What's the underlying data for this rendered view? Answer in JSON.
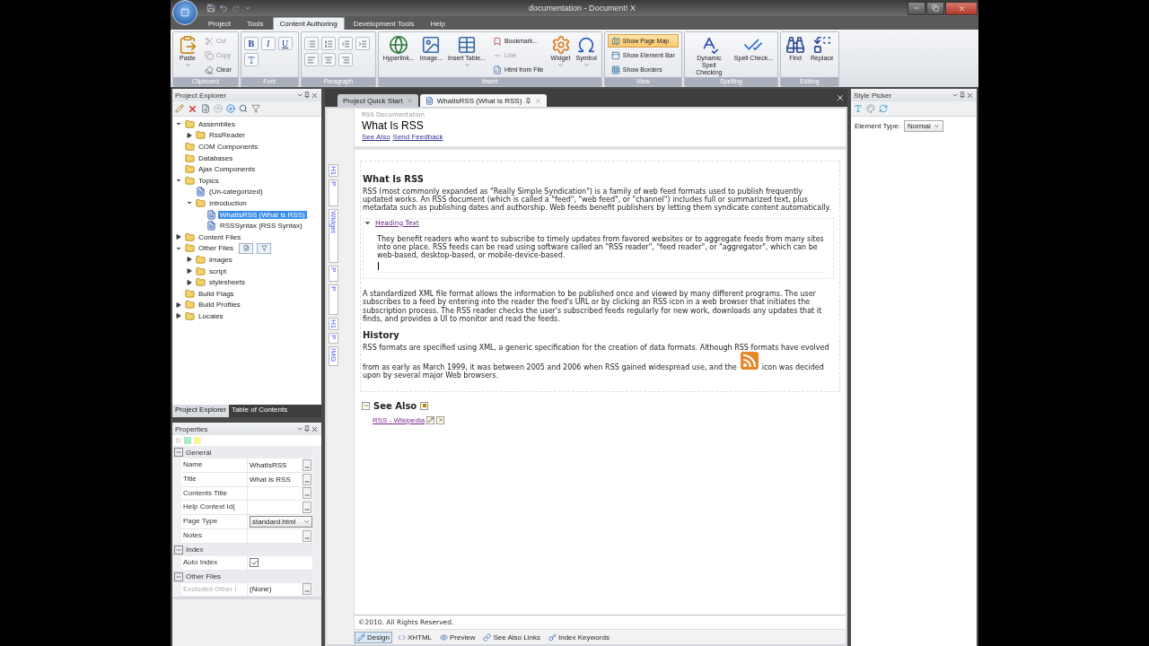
{
  "window": {
    "title": "documentation - Document! X"
  },
  "menu_tabs": [
    {
      "label": "Project",
      "selected": false
    },
    {
      "label": "Tools",
      "selected": false
    },
    {
      "label": "Content Authoring",
      "selected": true
    },
    {
      "label": "Development Tools",
      "selected": false
    },
    {
      "label": "Help",
      "selected": false
    }
  ],
  "ribbon": {
    "groups": [
      {
        "label": "Clipboard",
        "items": [
          {
            "label": "Paste",
            "kind": "large",
            "dropdown": true,
            "disabled": false
          },
          {
            "label": "Cut",
            "kind": "small",
            "disabled": true
          },
          {
            "label": "Copy",
            "kind": "small",
            "disabled": true
          },
          {
            "label": "Clear",
            "kind": "small",
            "disabled": false
          }
        ]
      },
      {
        "label": "Font",
        "items": [
          {
            "glyph": "B",
            "kind": "glyph"
          },
          {
            "glyph": "I",
            "kind": "glyph"
          },
          {
            "glyph": "U",
            "kind": "glyph"
          },
          {
            "kind": "icon"
          }
        ]
      },
      {
        "label": "Paragraph",
        "items": [
          {
            "kind": "icon"
          },
          {
            "kind": "icon"
          },
          {
            "kind": "icon"
          },
          {
            "kind": "icon"
          },
          {
            "kind": "icon"
          },
          {
            "kind": "icon"
          },
          {
            "kind": "icon"
          }
        ]
      },
      {
        "label": "Insert",
        "items": [
          {
            "label": "Hyperlink...",
            "kind": "large",
            "dropdown": false,
            "disabled": false
          },
          {
            "label": "Image...",
            "kind": "large",
            "dropdown": false,
            "disabled": false
          },
          {
            "label": "Insert Table...",
            "kind": "large",
            "dropdown": true,
            "disabled": false
          },
          {
            "label": "Bookmark...",
            "kind": "small",
            "disabled": false
          },
          {
            "label": "Line",
            "kind": "small",
            "disabled": true
          },
          {
            "label": "Html from File",
            "kind": "small",
            "disabled": false
          },
          {
            "label": "Widget",
            "kind": "large",
            "dropdown": true,
            "disabled": false
          },
          {
            "label": "Symbol",
            "kind": "large",
            "dropdown": true,
            "disabled": false
          }
        ]
      },
      {
        "label": "View",
        "items": [
          {
            "label": "Show Page Map",
            "kind": "small",
            "on": true,
            "disabled": false
          },
          {
            "label": "Show Element Bar",
            "kind": "small",
            "on": false,
            "disabled": false
          },
          {
            "label": "Show Borders",
            "kind": "small",
            "on": false,
            "disabled": false
          }
        ]
      },
      {
        "label": "Spelling",
        "items": [
          {
            "label": "Dynamic Spell Checking",
            "kind": "large",
            "dropdown": false,
            "disabled": false
          },
          {
            "label": "Spell Check...",
            "kind": "large",
            "dropdown": false,
            "disabled": false
          }
        ]
      },
      {
        "label": "Editing",
        "items": [
          {
            "label": "Find",
            "kind": "large",
            "dropdown": false,
            "disabled": false
          },
          {
            "label": "Replace",
            "kind": "large",
            "dropdown": false,
            "disabled": false
          }
        ]
      }
    ]
  },
  "project_explorer": {
    "title": "Project Explorer",
    "tree": [
      {
        "label": "Assemblies",
        "expanded": true,
        "selected": false,
        "children": [
          {
            "label": "RssReader",
            "expanded": false,
            "selected": false
          }
        ]
      },
      {
        "label": "COM Components",
        "selected": false
      },
      {
        "label": "Databases",
        "selected": false
      },
      {
        "label": "Ajax Components",
        "selected": false
      },
      {
        "label": "Topics",
        "expanded": true,
        "selected": false,
        "children": [
          {
            "label": "(Un-categorized)",
            "selected": false
          },
          {
            "label": "Introduction",
            "expanded": true,
            "selected": false,
            "children": [
              {
                "label": "WhatIsRSS (What Is RSS)",
                "selected": true
              },
              {
                "label": "RSSSyntax (RSS Syntax)",
                "selected": false
              }
            ]
          }
        ]
      },
      {
        "label": "Content Files",
        "expanded": false,
        "selected": false
      },
      {
        "label": "Other Files",
        "expanded": true,
        "selected": false,
        "actions": true,
        "children": [
          {
            "label": "images",
            "expanded": false,
            "selected": false
          },
          {
            "label": "script",
            "expanded": false,
            "selected": false
          },
          {
            "label": "stylesheets",
            "expanded": false,
            "selected": false
          }
        ]
      },
      {
        "label": "Build Flags",
        "selected": false
      },
      {
        "label": "Build Profiles",
        "expanded": false,
        "selected": false
      },
      {
        "label": "Locales",
        "expanded": false,
        "selected": false
      }
    ],
    "tabs": [
      {
        "label": "Project Explorer",
        "selected": true
      },
      {
        "label": "Table of Contents",
        "selected": false
      }
    ]
  },
  "properties": {
    "title": "Properties",
    "categories": [
      {
        "name": "General",
        "expanded": true,
        "rows": [
          {
            "name": "Name",
            "value": "WhatIsRSS",
            "kind": "text",
            "disabled": false
          },
          {
            "name": "Title",
            "value": "What Is RSS",
            "kind": "text",
            "disabled": false
          },
          {
            "name": "Contents Title",
            "kind": "text",
            "disabled": false
          },
          {
            "name": "Help Context Id(",
            "kind": "text",
            "disabled": false
          },
          {
            "name": "Page Type",
            "value": "standard.html",
            "kind": "dropdown",
            "disabled": false
          },
          {
            "name": "Notes",
            "kind": "text",
            "disabled": false
          }
        ]
      },
      {
        "name": "Index",
        "expanded": true,
        "rows": [
          {
            "name": "Auto Index",
            "kind": "checkbox",
            "checked": true,
            "disabled": false
          }
        ]
      },
      {
        "name": "Other Files",
        "expanded": true,
        "rows": [
          {
            "name": "Excluded Other I",
            "value": "(None)",
            "kind": "text",
            "disabled": true
          }
        ]
      }
    ]
  },
  "doc_tabs": [
    {
      "label": "Project Quick Start",
      "selected": false
    },
    {
      "label": "WhatIsRSS (What Is RSS)",
      "selected": true
    }
  ],
  "gutter_tags": [
    "H1",
    "P",
    "Widget",
    "P",
    "P",
    "H1",
    "P",
    "IMG"
  ],
  "page": {
    "breadcrumb": "RSS Documentation",
    "title": "What Is RSS",
    "links": [
      "See Also",
      "Send Feedback"
    ],
    "blocks": [
      {
        "kind": "heading",
        "text": "What Is RSS"
      },
      {
        "kind": "paragraph",
        "text": "RSS (most commonly expanded as \"Really Simple Syndication\") is a family of web feed formats used to publish frequently updated works. An RSS document (which is called a \"feed\", \"web feed\", or \"channel\") includes full or summarized text, plus metadata such as publishing dates and authorship. Web feeds benefit publishers by letting them syndicate content automatically."
      },
      {
        "kind": "widget",
        "heading": "Heading Text",
        "expanded": true,
        "text": "They benefit readers who want to subscribe to timely updates from favored websites or to aggregate feeds from many sites into one place. RSS feeds can be read using software called an \"RSS reader\", \"feed reader\", or \"aggregator\", which can be web-based, desktop-based, or mobile-device-based."
      },
      {
        "kind": "paragraph",
        "text": "A standardized XML file format allows the information to be published once and viewed by many different programs. The user subscribes to a feed by entering into the reader the feed's URL or by clicking an RSS icon in a web browser that initiates the subscription process. The RSS reader checks the user's subscribed feeds regularly for new work, downloads any updates that it finds, and provides a UI to monitor and read the feeds."
      },
      {
        "kind": "heading",
        "text": "History"
      },
      {
        "kind": "icon_paragraph",
        "before": "RSS formats are specified using XML, a generic specification for the creation of data formats. Although RSS formats have evolved from as early as March 1999, it was between 2005 and 2006 when RSS gained widespread use, and the",
        "after": "icon was decided upon by several major Web browsers."
      }
    ],
    "see_also": {
      "title": "See Also",
      "links": [
        "RSS - Wikipedia"
      ]
    },
    "footer": "©2010. All Rights Reserved."
  },
  "view_tabs": [
    {
      "label": "Design",
      "selected": true
    },
    {
      "label": "XHTML",
      "selected": false
    },
    {
      "label": "Preview",
      "selected": false
    },
    {
      "label": "See Also Links",
      "selected": false
    },
    {
      "label": "Index Keywords",
      "selected": false
    }
  ],
  "style_picker": {
    "title": "Style Picker",
    "element_type_label": "Element Type:",
    "element_type": "Normal"
  }
}
